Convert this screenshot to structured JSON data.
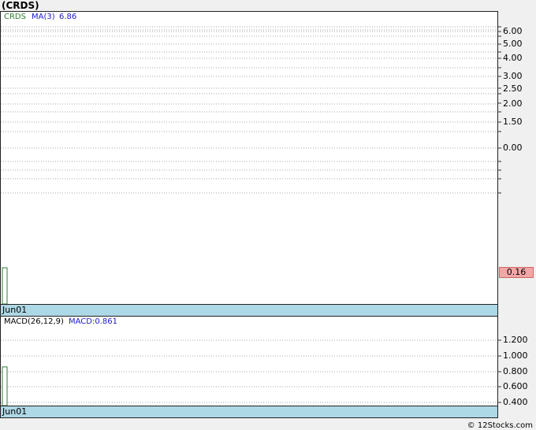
{
  "title": "(CRDS)",
  "chart_data": [
    {
      "type": "bar",
      "panel": "price",
      "legend": {
        "symbol": "CRDS",
        "ma_label": "MA(3)",
        "ma_value": "6.86"
      },
      "yticks": [
        "6.00",
        "5.00",
        "4.00",
        "3.00",
        "2.50",
        "2.00",
        "1.50",
        "0.00"
      ],
      "last_price": "0.16",
      "x_label": "Jun01",
      "series": [
        {
          "values": [
            0.16
          ]
        }
      ],
      "grid": true
    },
    {
      "type": "bar",
      "panel": "macd",
      "legend": {
        "indicator": "MACD(26,12,9)",
        "value_label": "MACD:0.861"
      },
      "yticks": [
        "1.200",
        "1.000",
        "0.800",
        "0.600",
        "0.400"
      ],
      "ylim": [
        0.35,
        1.4
      ],
      "x_label": "Jun01",
      "series": [
        {
          "values": [
            0.861
          ]
        }
      ],
      "grid": true
    }
  ],
  "footer": "© 12Stocks.com",
  "colors": {
    "bar": "#2e7d32",
    "legend_symbol": "#2e7d32",
    "legend_ma": "#1a1acc",
    "date_bar": "#add8e6",
    "price_badge": "#f4a6a6"
  }
}
